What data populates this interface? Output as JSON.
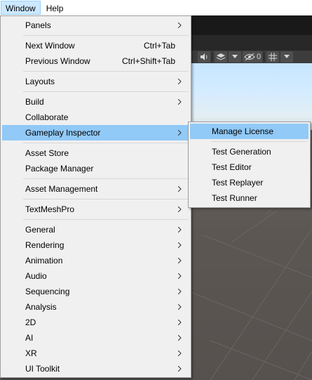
{
  "menubar": {
    "items": [
      {
        "label": "Window",
        "active": true
      },
      {
        "label": "Help",
        "active": false
      }
    ]
  },
  "toolbar": {
    "audio_icon": "speaker-icon",
    "layers_icon": "layers-icon",
    "visibility_icon": "eye-slash-icon",
    "hidden_count": "0",
    "grid_icon": "grid-icon"
  },
  "window_menu": {
    "items": [
      {
        "label": "Panels",
        "submenu": true
      },
      {
        "separator": true
      },
      {
        "label": "Next Window",
        "shortcut": "Ctrl+Tab"
      },
      {
        "label": "Previous Window",
        "shortcut": "Ctrl+Shift+Tab"
      },
      {
        "separator": true
      },
      {
        "label": "Layouts",
        "submenu": true
      },
      {
        "separator": true
      },
      {
        "label": "Build",
        "submenu": true
      },
      {
        "label": "Collaborate"
      },
      {
        "label": "Gameplay Inspector",
        "submenu": true,
        "highlighted": true
      },
      {
        "separator": true
      },
      {
        "label": "Asset Store"
      },
      {
        "label": "Package Manager"
      },
      {
        "separator": true
      },
      {
        "label": "Asset Management",
        "submenu": true
      },
      {
        "separator": true
      },
      {
        "label": "TextMeshPro",
        "submenu": true
      },
      {
        "separator": true
      },
      {
        "label": "General",
        "submenu": true
      },
      {
        "label": "Rendering",
        "submenu": true
      },
      {
        "label": "Animation",
        "submenu": true
      },
      {
        "label": "Audio",
        "submenu": true
      },
      {
        "label": "Sequencing",
        "submenu": true
      },
      {
        "label": "Analysis",
        "submenu": true
      },
      {
        "label": "2D",
        "submenu": true
      },
      {
        "label": "AI",
        "submenu": true
      },
      {
        "label": "XR",
        "submenu": true
      },
      {
        "label": "UI Toolkit",
        "submenu": true
      }
    ]
  },
  "gameplay_inspector_submenu": {
    "items": [
      {
        "label": "Manage License",
        "highlighted": true
      },
      {
        "separator": true
      },
      {
        "label": "Test Generation"
      },
      {
        "label": "Test Editor"
      },
      {
        "label": "Test Replayer"
      },
      {
        "label": "Test Runner"
      }
    ]
  },
  "colors": {
    "highlight": "#91c9f7",
    "menu_bg": "#f0f0f0",
    "menubar_active": "#cce8ff"
  }
}
